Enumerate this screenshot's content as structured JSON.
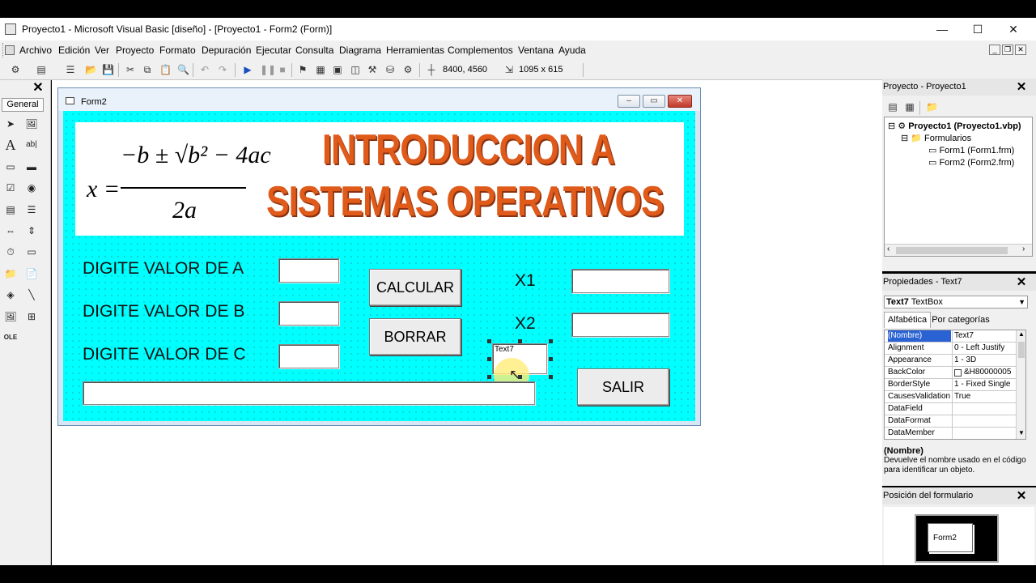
{
  "window": {
    "title": "Proyecto1 - Microsoft Visual Basic [diseño] - [Proyecto1 - Form2 (Form)]",
    "minimize": "—",
    "maximize": "☐",
    "close": "✕"
  },
  "menu": {
    "items": [
      "Archivo",
      "Edición",
      "Ver",
      "Proyecto",
      "Formato",
      "Depuración",
      "Ejecutar",
      "Consulta",
      "Diagrama",
      "Herramientas",
      "Complementos",
      "Ventana",
      "Ayuda"
    ]
  },
  "toolbar": {
    "position": "8400, 4560",
    "size": "1095 x 615"
  },
  "toolbox": {
    "tab": "General",
    "close": "✕"
  },
  "form": {
    "title": "Form2",
    "banner_line1": "INTRODUCCION A",
    "banner_line2": "SISTEMAS OPERATIVOS",
    "formula_x": "x =",
    "formula_num": "−b ± √b² − 4ac",
    "formula_den": "2a",
    "label_a": "DIGITE VALOR DE A",
    "label_b": "DIGITE VALOR DE B",
    "label_c": "DIGITE VALOR DE C",
    "calcular": "CALCULAR",
    "borrar": "BORRAR",
    "salir": "SALIR",
    "x1": "X1",
    "x2": "X2",
    "selected_textbox": "Text7"
  },
  "project_pane": {
    "title": "Proyecto - Proyecto1",
    "root": "Proyecto1 (Proyecto1.vbp)",
    "folder": "Formularios",
    "form1": "Form1 (Form1.frm)",
    "form2": "Form2 (Form2.frm)"
  },
  "properties_pane": {
    "title": "Propiedades - Text7",
    "object_name": "Text7",
    "object_type": "TextBox",
    "tab_alpha": "Alfabética",
    "tab_cat": "Por categorías",
    "rows": [
      {
        "name": "(Nombre)",
        "value": "Text7"
      },
      {
        "name": "Alignment",
        "value": "0 - Left Justify"
      },
      {
        "name": "Appearance",
        "value": "1 - 3D"
      },
      {
        "name": "BackColor",
        "value": "&H80000005"
      },
      {
        "name": "BorderStyle",
        "value": "1 - Fixed Single"
      },
      {
        "name": "CausesValidation",
        "value": "True"
      },
      {
        "name": "DataField",
        "value": ""
      },
      {
        "name": "DataFormat",
        "value": ""
      },
      {
        "name": "DataMember",
        "value": ""
      }
    ],
    "desc_title": "(Nombre)",
    "desc_text": "Devuelve el nombre usado en el código para identificar un objeto."
  },
  "formpos_pane": {
    "title": "Posición del formulario",
    "preview_label": "Form2"
  },
  "colors": {
    "form_back": "#00ffff",
    "banner_text": "#e05a1a"
  }
}
